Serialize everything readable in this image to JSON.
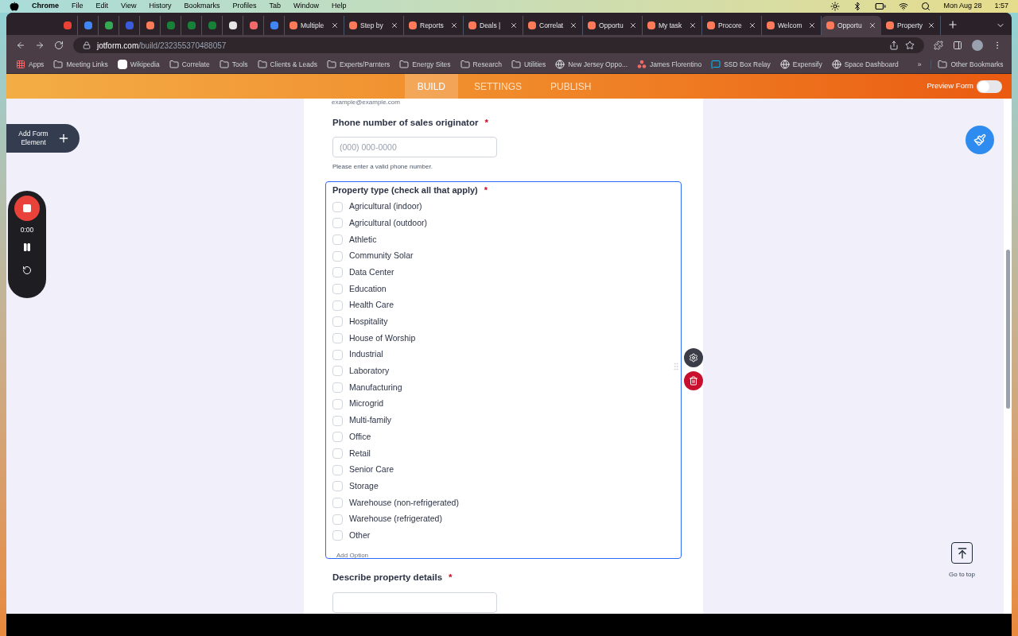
{
  "menu_bar": {
    "app": "Chrome",
    "items": [
      "File",
      "Edit",
      "View",
      "History",
      "Bookmarks",
      "Profiles",
      "Tab",
      "Window",
      "Help"
    ],
    "date": "Mon Aug 28",
    "time": "1:57"
  },
  "icon_tabs": [
    {
      "selected": false
    },
    {
      "selected": false
    },
    {
      "selected": false
    },
    {
      "selected": false
    },
    {
      "selected": false
    },
    {
      "selected": false
    },
    {
      "selected": false
    },
    {
      "selected": false
    },
    {
      "selected": false
    },
    {
      "selected": false
    },
    {
      "selected": false
    }
  ],
  "tabs": [
    {
      "label": "Multiple",
      "selected": false
    },
    {
      "label": "Step by",
      "selected": false
    },
    {
      "label": "Reports",
      "selected": false
    },
    {
      "label": "Deals |",
      "selected": false
    },
    {
      "label": "Correlat",
      "selected": false
    },
    {
      "label": "Opportu",
      "selected": false
    },
    {
      "label": "My task",
      "selected": false
    },
    {
      "label": "Procore",
      "selected": false
    },
    {
      "label": "Welcom",
      "selected": false
    },
    {
      "label": "Opportu",
      "selected": true
    },
    {
      "label": "Property",
      "selected": false
    }
  ],
  "address": {
    "host": "jotform.com",
    "path": "/build/232355370488057"
  },
  "bookmarks": [
    {
      "label": "Apps",
      "kind": "apps"
    },
    {
      "label": "Meeting Links",
      "kind": "folder"
    },
    {
      "label": "Wikipedia",
      "kind": "wiki"
    },
    {
      "label": "Correlate",
      "kind": "folder"
    },
    {
      "label": "Tools",
      "kind": "folder"
    },
    {
      "label": "Clients & Leads",
      "kind": "folder"
    },
    {
      "label": "Experts/Parnters",
      "kind": "folder"
    },
    {
      "label": "Energy Sites",
      "kind": "folder"
    },
    {
      "label": "Research",
      "kind": "folder"
    },
    {
      "label": "Utilities",
      "kind": "folder"
    },
    {
      "label": "New Jersey Oppo...",
      "kind": "globe"
    },
    {
      "label": "James Florentino",
      "kind": "dots"
    },
    {
      "label": "SSD Box Relay",
      "kind": "chat"
    },
    {
      "label": "Expensify",
      "kind": "globe"
    },
    {
      "label": "Space Dashboard",
      "kind": "globe"
    }
  ],
  "bookmarks_more": "»",
  "other_bookmarks": "Other Bookmarks",
  "builder_tabs": [
    {
      "label": "BUILD",
      "selected": true
    },
    {
      "label": "SETTINGS",
      "selected": false
    },
    {
      "label": "PUBLISH",
      "selected": false
    }
  ],
  "preview_form": {
    "label": "Preview Form",
    "on": false
  },
  "add_element": "Add Form Element",
  "recorder": {
    "time": "0:00"
  },
  "form": {
    "email_sublabel": "example@example.com",
    "phone": {
      "label": "Phone number of sales originator",
      "required_mark": "*",
      "placeholder": "(000) 000-0000",
      "hint": "Please enter a valid phone number."
    },
    "property_type": {
      "label": "Property type (check all that apply)",
      "required_mark": "*",
      "selected": true,
      "add_option": "Add Option",
      "options": [
        {
          "label": "Agricultural (indoor)",
          "checked": false
        },
        {
          "label": "Agricultural (outdoor)",
          "checked": false
        },
        {
          "label": "Athletic",
          "checked": false
        },
        {
          "label": "Community Solar",
          "checked": false
        },
        {
          "label": "Data Center",
          "checked": false
        },
        {
          "label": "Education",
          "checked": false
        },
        {
          "label": "Health Care",
          "checked": false
        },
        {
          "label": "Hospitality",
          "checked": false
        },
        {
          "label": "House of Worship",
          "checked": false
        },
        {
          "label": "Industrial",
          "checked": false
        },
        {
          "label": "Laboratory",
          "checked": false
        },
        {
          "label": "Manufacturing",
          "checked": false
        },
        {
          "label": "Microgrid",
          "checked": false
        },
        {
          "label": "Multi-family",
          "checked": false
        },
        {
          "label": "Office",
          "checked": false
        },
        {
          "label": "Retail",
          "checked": false
        },
        {
          "label": "Senior Care",
          "checked": false
        },
        {
          "label": "Storage",
          "checked": false
        },
        {
          "label": "Warehouse (non-refrigerated)",
          "checked": false
        },
        {
          "label": "Warehouse (refrigerated)",
          "checked": false
        },
        {
          "label": "Other",
          "checked": false
        }
      ]
    },
    "details": {
      "label": "Describe property details",
      "required_mark": "*"
    }
  },
  "go_to_top": "Go to top"
}
